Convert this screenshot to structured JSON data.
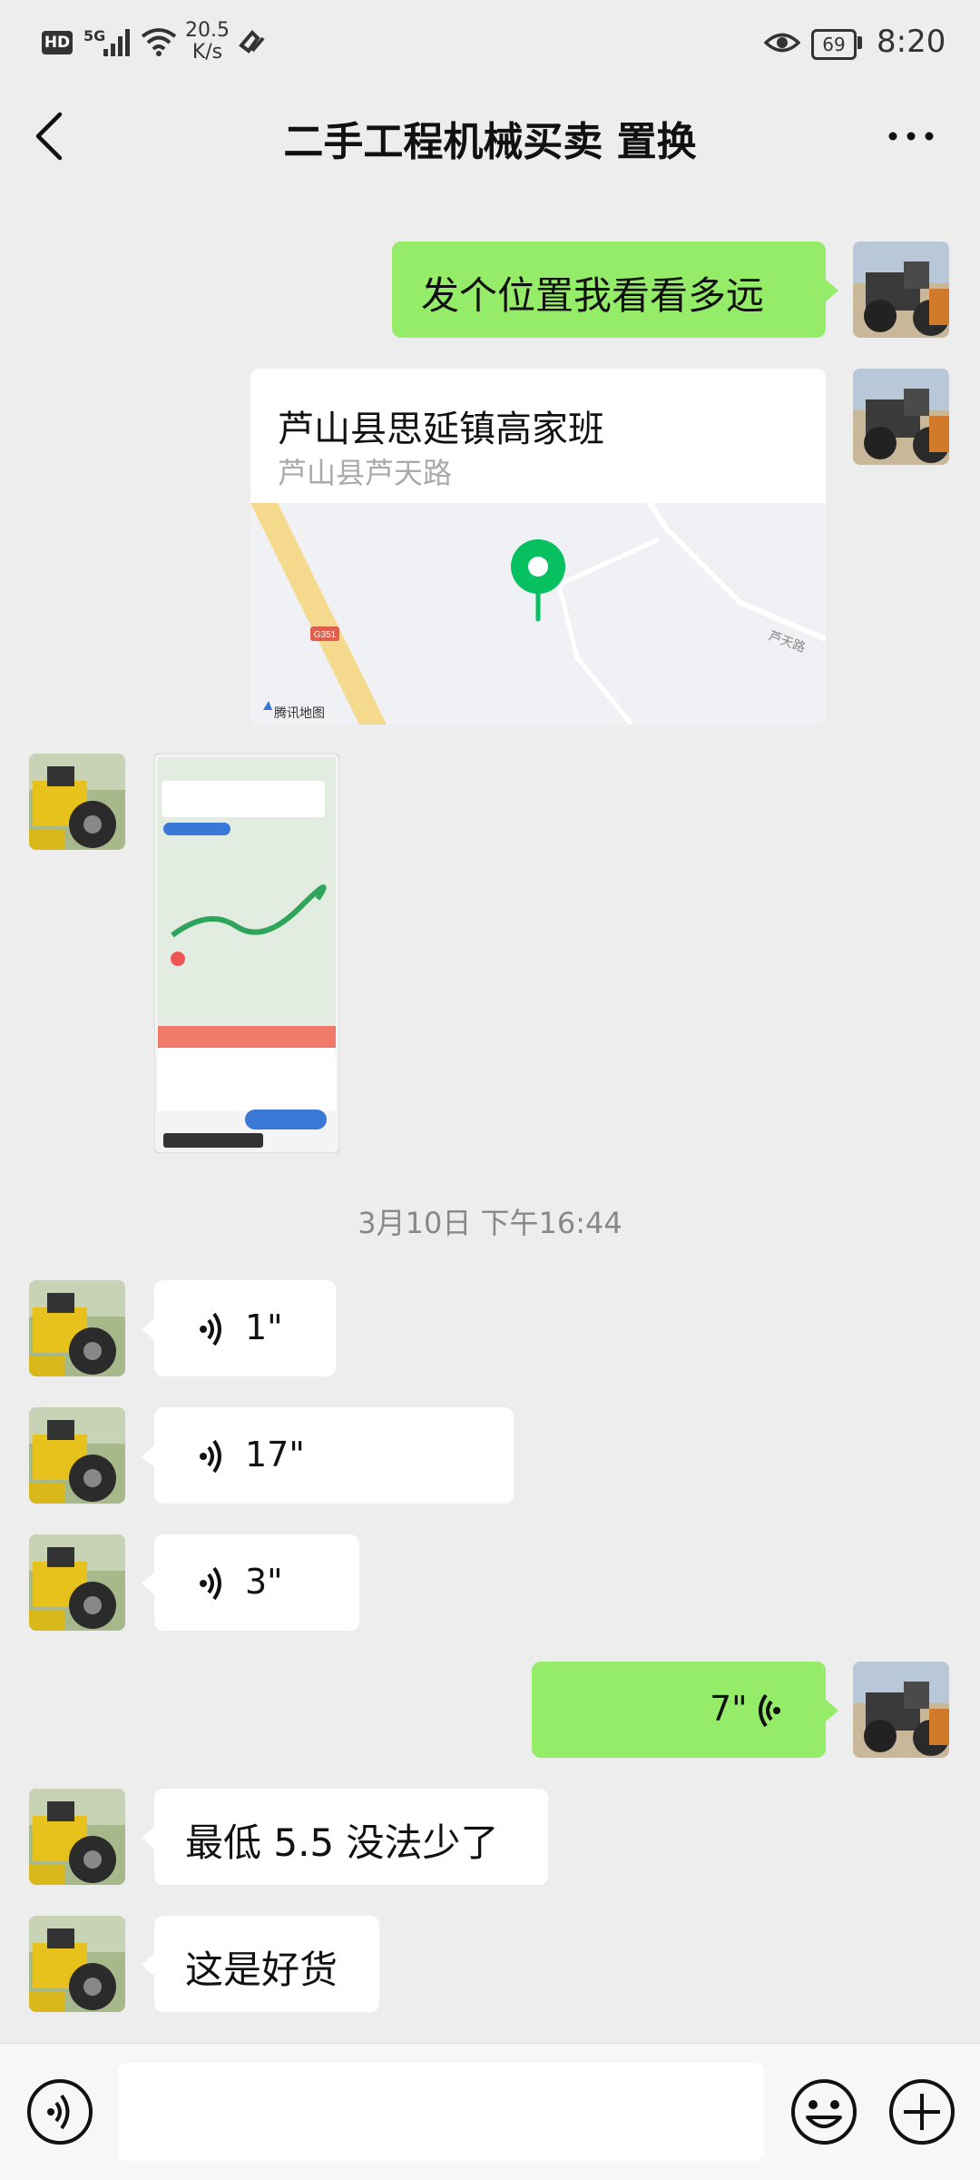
{
  "status_bar": {
    "hd_label": "HD",
    "network_label": "5G",
    "speed_value": "20.5",
    "speed_unit": "K/s",
    "battery": "69",
    "time": "8:20"
  },
  "header": {
    "title": "二手工程机械买卖 置换"
  },
  "messages": {
    "m1_text": "发个位置我看看多远",
    "location": {
      "title": "芦山县思延镇高家班",
      "address": "芦山县芦天路",
      "road_badge": "G351",
      "road_label": "芦天路",
      "provider": "腾讯地图"
    },
    "timestamp": "3月10日 下午16:44",
    "voice1": "1\"",
    "voice2": "17\"",
    "voice3": "3\"",
    "voice_out": "7\"",
    "m_text1": "最低 5.5 没法少了",
    "m_text2": "这是好货"
  },
  "colors": {
    "bubble_out": "#95ec69",
    "bubble_in": "#ffffff",
    "background": "#ededed",
    "pin": "#07c160"
  }
}
